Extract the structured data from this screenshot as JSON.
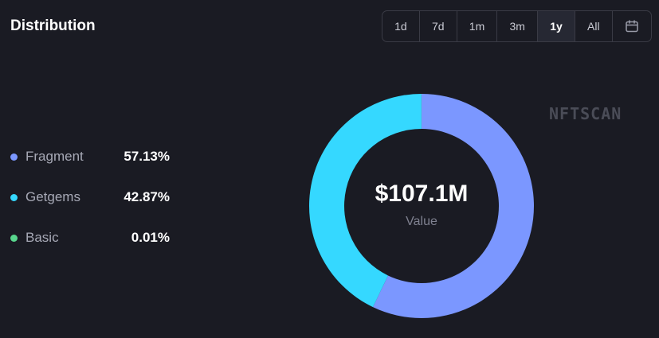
{
  "header": {
    "title": "Distribution"
  },
  "time_ranges": {
    "options": [
      "1d",
      "7d",
      "1m",
      "3m",
      "1y",
      "All"
    ],
    "selected": "1y",
    "calendar_icon": "calendar-icon"
  },
  "watermark": "NFTSCAN",
  "center": {
    "value": "$107.1M",
    "label": "Value"
  },
  "legend": [
    {
      "name": "Fragment",
      "percent": "57.13%",
      "color": "#7b97ff"
    },
    {
      "name": "Getgems",
      "percent": "42.87%",
      "color": "#35d8ff"
    },
    {
      "name": "Basic",
      "percent": "0.01%",
      "color": "#58d68d"
    }
  ],
  "chart_data": {
    "type": "pie",
    "style": "donut",
    "categories": [
      "Fragment",
      "Getgems",
      "Basic"
    ],
    "values": [
      57.13,
      42.87,
      0.01
    ],
    "unit": "%",
    "colors": [
      "#7b97ff",
      "#35d8ff",
      "#58d68d"
    ],
    "center_text": "$107.1M",
    "center_subtext": "Value",
    "legend_position": "left"
  }
}
